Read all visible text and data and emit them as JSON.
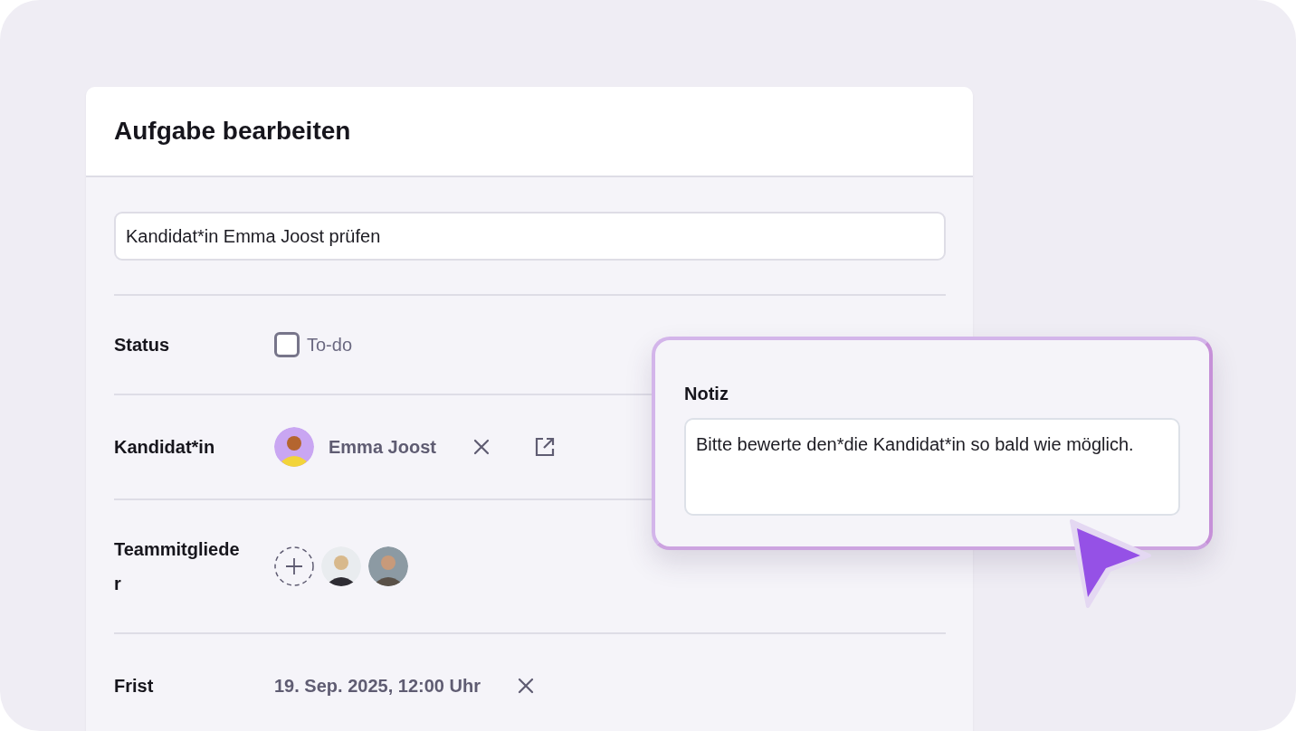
{
  "card": {
    "title": "Aufgabe bearbeiten",
    "task_title": {
      "value": "Kandidat*in Emma Joost prüfen"
    },
    "fields": [
      {
        "kind": "status",
        "label": "Status",
        "checked": false,
        "text": "To-do"
      },
      {
        "kind": "candidate",
        "label": "Kandidat*in",
        "name": "Emma Joost"
      },
      {
        "kind": "team",
        "label": "Teammitglieder"
      },
      {
        "kind": "deadline",
        "label": "Frist",
        "value": "19. Sep. 2025, 12:00 Uhr"
      }
    ]
  },
  "note": {
    "label": "Notiz",
    "value": "Bitte bewerte den*die Kandidat*in so bald wie möglich."
  }
}
